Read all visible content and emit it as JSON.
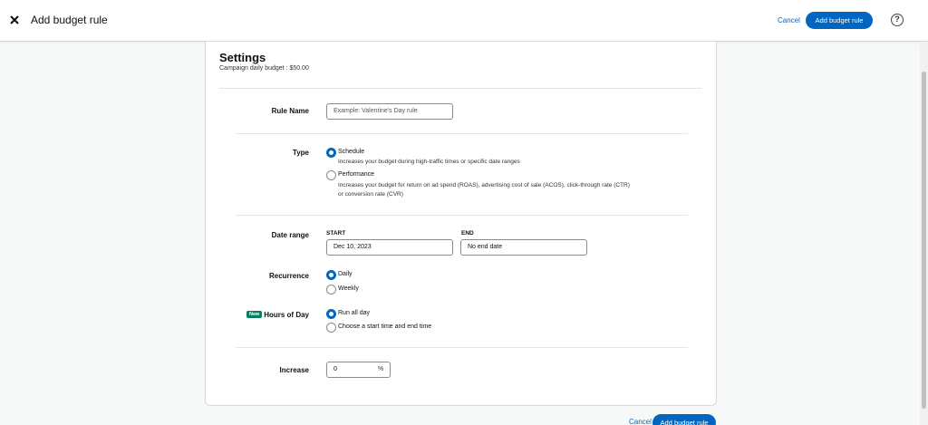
{
  "header": {
    "title": "Add budget rule",
    "cancel_label": "Cancel",
    "primary_label": "Add budget rule",
    "help_glyph": "?"
  },
  "settings": {
    "title": "Settings",
    "subtitle": "Campaign daily budget : $50.00"
  },
  "rule_name": {
    "label": "Rule Name",
    "value": "",
    "placeholder": "Example: Valentine's Day rule"
  },
  "type": {
    "label": "Type",
    "options": [
      {
        "label": "Schedule",
        "description": "Increases your budget during high-traffic times or specific date ranges",
        "checked": true
      },
      {
        "label": "Performance",
        "description_line1": "Increases your budget for return on ad spend (ROAS), advertising cost of sale (ACOS), click-through rate (CTR)",
        "description_line2": "or conversion rate (CVR)",
        "checked": false
      }
    ]
  },
  "date_range": {
    "label": "Date range",
    "start_head": "START",
    "start_value": "Dec 10, 2023",
    "end_head": "END",
    "end_value": "No end date"
  },
  "recurrence": {
    "label": "Recurrence",
    "options": [
      {
        "label": "Daily",
        "checked": true
      },
      {
        "label": "Weekly",
        "checked": false
      }
    ]
  },
  "hours_of_day": {
    "badge": "New",
    "label": "Hours of Day",
    "options": [
      {
        "label": "Run all day",
        "checked": true
      },
      {
        "label": "Choose a start time and end time",
        "checked": false
      }
    ]
  },
  "increase": {
    "label": "Increase",
    "value": "0",
    "unit": "%"
  },
  "footer": {
    "cancel_label": "Cancel",
    "primary_label": "Add budget rule"
  },
  "colors": {
    "accent": "#0066c0",
    "badge": "#067d62"
  }
}
